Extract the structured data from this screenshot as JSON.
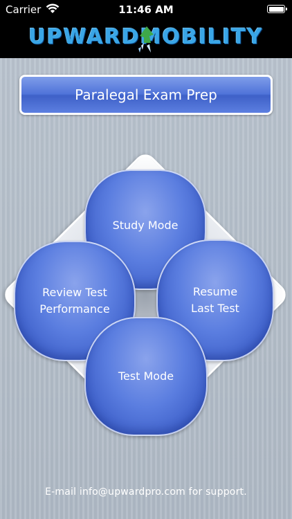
{
  "status_bar": {
    "carrier": "Carrier",
    "time": "11:46 AM",
    "wifi_icon": "wifi-icon",
    "battery_icon": "battery-icon"
  },
  "header": {
    "logo_text": "UPWARDMOBILITY",
    "logo_icon": "upward-arrow-logo-icon"
  },
  "title": "Paralegal Exam Prep",
  "menu": {
    "study_mode": "Study Mode",
    "review_line1": "Review Test",
    "review_line2": "Performance",
    "resume_line1": "Resume",
    "resume_line2": "Last Test",
    "test_mode": "Test Mode"
  },
  "support_text": "E-mail info@upwardpro.com for support.",
  "colors": {
    "accent_blue": "#4f73d9",
    "logo_blue": "#3aa6e6",
    "background": "#b4bec9",
    "header": "#000000"
  }
}
